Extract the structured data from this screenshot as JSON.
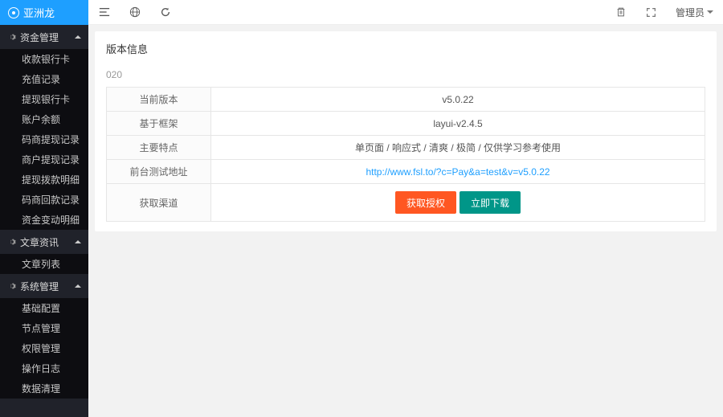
{
  "brand": "亚洲龙",
  "topbar": {
    "admin_label": "管理员"
  },
  "sidebar": {
    "groups": [
      {
        "title": "资金管理",
        "items": [
          "收款银行卡",
          "充值记录",
          "提现银行卡",
          "账户余额",
          "码商提现记录",
          "商户提现记录",
          "提现拨款明细",
          "码商回款记录",
          "资金变动明细"
        ]
      },
      {
        "title": "文章资讯",
        "items": [
          "文章列表"
        ]
      },
      {
        "title": "系统管理",
        "items": [
          "基础配置",
          "节点管理",
          "权限管理",
          "操作日志",
          "数据清理"
        ]
      }
    ]
  },
  "page": {
    "title": "版本信息",
    "breadcrumb": "020",
    "rows": [
      {
        "label": "当前版本",
        "value": "v5.0.22"
      },
      {
        "label": "基于框架",
        "value": "layui-v2.4.5"
      },
      {
        "label": "主要特点",
        "value": "单页面 / 响应式 / 清爽 / 极简 / 仅供学习参考使用"
      },
      {
        "label": "前台测试地址",
        "link": "http://www.fsl.to/?c=Pay&a=test&v=v5.0.22"
      },
      {
        "label": "获取渠道",
        "buttons": [
          {
            "text": "获取授权",
            "cls": "btn-orange"
          },
          {
            "text": "立即下载",
            "cls": "btn-green"
          }
        ]
      }
    ]
  }
}
